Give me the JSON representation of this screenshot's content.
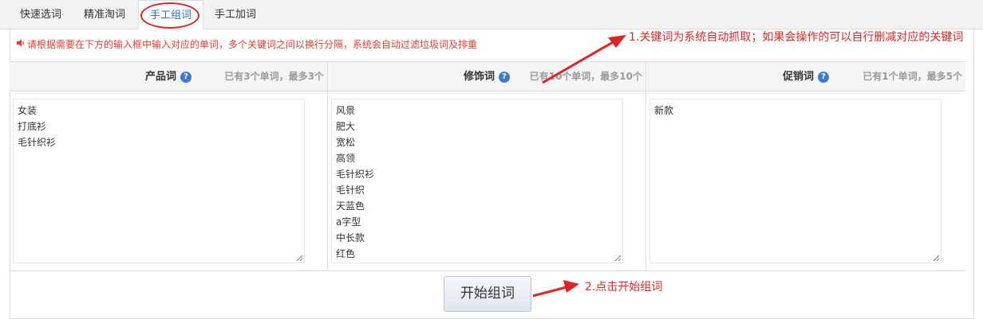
{
  "tabs": [
    {
      "label": "快速选词"
    },
    {
      "label": "精准淘词"
    },
    {
      "label": "手工组词"
    },
    {
      "label": "手工加词"
    }
  ],
  "notice": "请根据需要在下方的输入框中输入对应的单词，多个关键词之间以换行分隔，系统会自动过滤垃圾词及排重",
  "annotations": {
    "note1": "1.关键词为系统自动抓取；如果会操作的可以自行删减对应的关键词",
    "note2": "2.点击开始组词",
    "color": "#e02424"
  },
  "columns": [
    {
      "title": "产品词",
      "count": "已有3个单词，最多3个",
      "words": [
        "女装",
        "打底衫",
        "毛针织衫"
      ]
    },
    {
      "title": "修饰词",
      "count": "已有10个单词，最多10个",
      "words": [
        "风景",
        "肥大",
        "宽松",
        "高领",
        "毛针织衫",
        "毛针织",
        "天蓝色",
        "a字型",
        "中长款",
        "红色"
      ]
    },
    {
      "title": "促销词",
      "count": "已有1个单词，最多5个",
      "words": [
        "新款"
      ]
    }
  ],
  "start_button": "开始组词",
  "colors": {
    "accent": "#2e6fd0",
    "notice": "#e33b2e",
    "help": "#3a7bd5"
  }
}
